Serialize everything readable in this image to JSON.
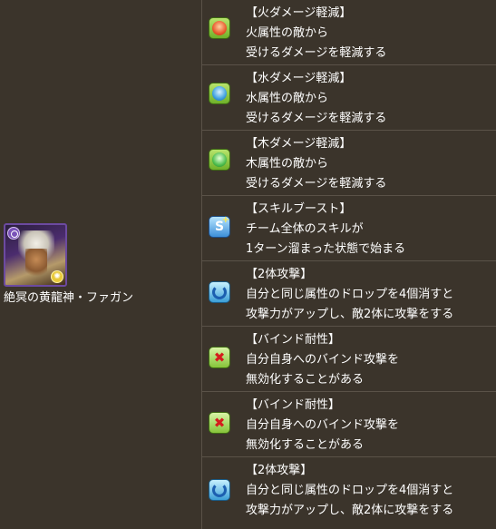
{
  "monster": {
    "name": "絶冥の黄龍神・ファガン",
    "main_attribute": "dark",
    "sub_attribute": "light",
    "colors": {
      "main_attribute": "#7a52b8",
      "sub_attribute": "#e8c93a"
    }
  },
  "awakenings": [
    {
      "icon": "fire-damage-reduction-icon",
      "title": "【火ダメージ軽減】",
      "line1": "火属性の敵から",
      "line2": "受けるダメージを軽減する"
    },
    {
      "icon": "water-damage-reduction-icon",
      "title": "【水ダメージ軽減】",
      "line1": "水属性の敵から",
      "line2": "受けるダメージを軽減する"
    },
    {
      "icon": "wood-damage-reduction-icon",
      "title": "【木ダメージ軽減】",
      "line1": "木属性の敵から",
      "line2": "受けるダメージを軽減する"
    },
    {
      "icon": "skill-boost-icon",
      "title": "【スキルブースト】",
      "line1": "チーム全体のスキルが",
      "line2": "1ターン溜まった状態で始まる"
    },
    {
      "icon": "two-pronged-attack-icon",
      "title": "【2体攻撃】",
      "line1": "自分と同じ属性のドロップを4個消すと",
      "line2": "攻撃力がアップし、敵2体に攻撃をする"
    },
    {
      "icon": "bind-resist-icon",
      "title": "【バインド耐性】",
      "line1": "自分自身へのバインド攻撃を",
      "line2": "無効化することがある"
    },
    {
      "icon": "bind-resist-icon",
      "title": "【バインド耐性】",
      "line1": "自分自身へのバインド攻撃を",
      "line2": "無効化することがある"
    },
    {
      "icon": "two-pronged-attack-icon",
      "title": "【2体攻撃】",
      "line1": "自分と同じ属性のドロップを4個消すと",
      "line2": "攻撃力がアップし、敵2体に攻撃をする"
    }
  ]
}
